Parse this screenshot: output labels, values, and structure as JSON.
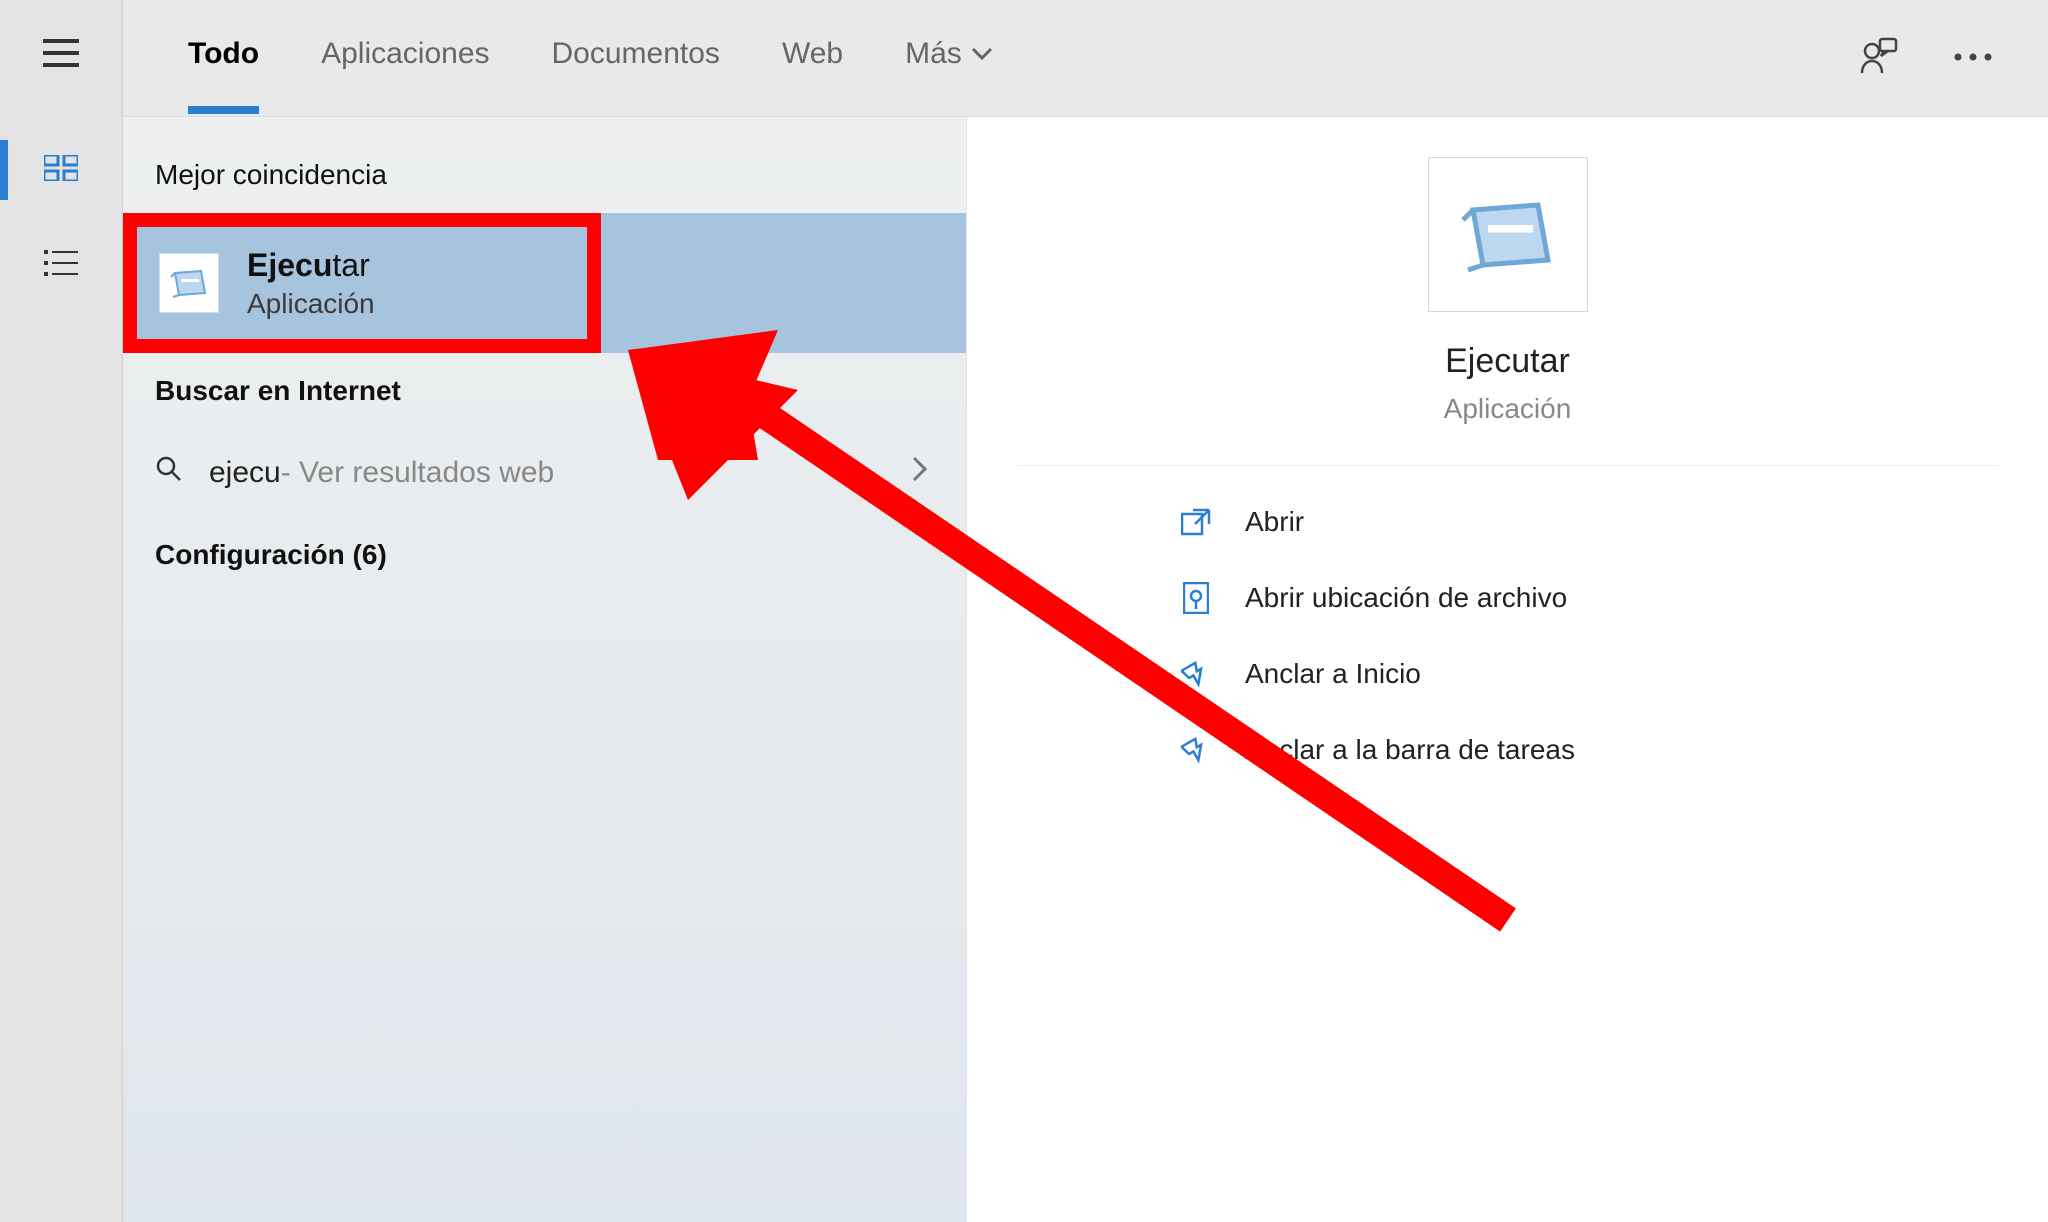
{
  "rail": {
    "icons": [
      "hamburger",
      "grid",
      "list"
    ]
  },
  "tabs": {
    "all": "Todo",
    "apps": "Aplicaciones",
    "documents": "Documentos",
    "web": "Web",
    "more": "Más"
  },
  "results": {
    "best_match_label": "Mejor coincidencia",
    "best_match": {
      "title_prefix": "Ejecu",
      "title_suffix": "tar",
      "subtitle": "Aplicación"
    },
    "search_internet_label": "Buscar en Internet",
    "web_query_prefix": "ejecu",
    "web_query_suffix": " - Ver resultados web",
    "config_label": "Configuración (6)"
  },
  "details": {
    "title": "Ejecutar",
    "subtitle": "Aplicación",
    "actions": {
      "open": "Abrir",
      "open_location": "Abrir ubicación de archivo",
      "pin_start": "Anclar a Inicio",
      "pin_taskbar": "Anclar a la barra de tareas"
    }
  }
}
